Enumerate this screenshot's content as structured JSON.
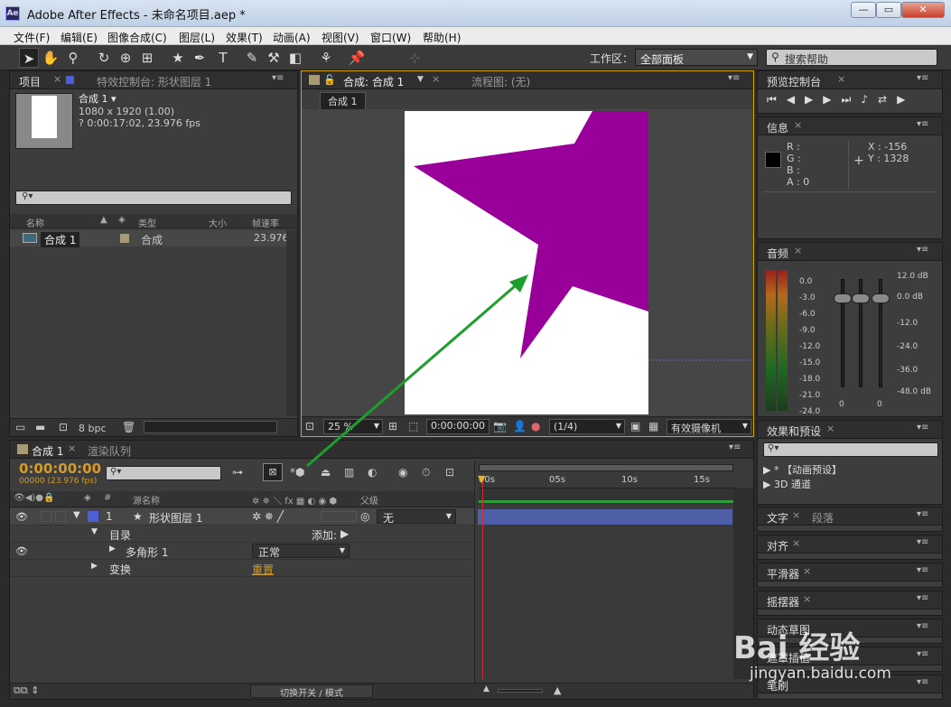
{
  "window": {
    "title": "Adobe After Effects - 未命名项目.aep *",
    "logo": "Ae",
    "minimize": "—",
    "restore": "▭",
    "close": "✕"
  },
  "menu": [
    "文件(F)",
    "编辑(E)",
    "图像合成(C)",
    "图层(L)",
    "效果(T)",
    "动画(A)",
    "视图(V)",
    "窗口(W)",
    "帮助(H)"
  ],
  "toolbar": {
    "workspace_label": "工作区：",
    "workspace_value": "全部面板",
    "search_help": "搜索帮助",
    "tools": [
      "selection-tool-icon",
      "hand-tool-icon",
      "zoom-tool-icon",
      "rotation-tool-icon",
      "orbit-camera-icon",
      "pan-behind-icon",
      "shape-star-icon",
      "pen-tool-icon",
      "text-tool-icon",
      "brush-tool-icon",
      "clone-stamp-icon",
      "eraser-tool-icon",
      "roto-brush-icon",
      "puppet-pin-icon"
    ]
  },
  "project": {
    "tab": "项目",
    "effect_tab": "特效控制台: 形状图层 1",
    "comp_name": "合成 1 ▾",
    "size": "1080 x 1920 (1.00)",
    "duration": "? 0:00:17:02, 23.976 fps",
    "col_name": "名称",
    "col_type": "类型",
    "col_size": "大小",
    "col_rate": "帧速率",
    "item_name": "合成 1",
    "item_type": "合成",
    "item_rate": "23.976",
    "bpc": "8 bpc"
  },
  "comp_viewer": {
    "tab": "合成: 合成 1",
    "flow_tab": "流程图: (无)",
    "breadcrumb": "合成 1",
    "zoom": "25 %",
    "timecode": "0:00:00:00",
    "resolution": "(1/4)",
    "camera": "有效摄像机",
    "star_color": "#990099"
  },
  "preview": {
    "tab": "预览控制台"
  },
  "info": {
    "tab": "信息",
    "r": "R :",
    "g": "G :",
    "b": "B :",
    "a": "A : 0",
    "x": "X : -156",
    "y": "Y : 1328"
  },
  "audio": {
    "tab": "音频",
    "left_scale": [
      "0.0",
      "-3.0",
      "-6.0",
      "-9.0",
      "-12.0",
      "-15.0",
      "-18.0",
      "-21.0",
      "-24.0"
    ],
    "right_scale": [
      "12.0 dB",
      "0.0 dB",
      "-12.0",
      "-24.0",
      "-36.0",
      "-48.0 dB"
    ],
    "zero": "0"
  },
  "effects": {
    "tab": "效果和预设",
    "item1": "* 【动画预设】",
    "item2": "3D 通道"
  },
  "side_panels": {
    "char": "文字",
    "para": "段落",
    "align": "对齐",
    "smoother": "平滑器",
    "wiggler": "摇摆器",
    "motion": "动态草图",
    "mask": "遮罩插值",
    "brush": "笔刷"
  },
  "timeline": {
    "tab": "合成 1",
    "render_tab": "渲染队列",
    "timecode": "0:00:00:00",
    "frames": "00000 (23.976 fps)",
    "col_source": "源名称",
    "col_parent": "父级",
    "layer_num": "1",
    "layer_name": "形状图层 1",
    "parent_value": "无",
    "contents": "目录",
    "add_label": "添加:",
    "polygon": "多角形 1",
    "blend": "正常",
    "transform": "变换",
    "reset": "重置",
    "ticks": [
      "00s",
      "05s",
      "10s",
      "15s"
    ],
    "switches_mode": "切换开关 / 模式"
  },
  "watermark": {
    "text": "Bai 经验",
    "url": "jingyan.baidu.com"
  }
}
